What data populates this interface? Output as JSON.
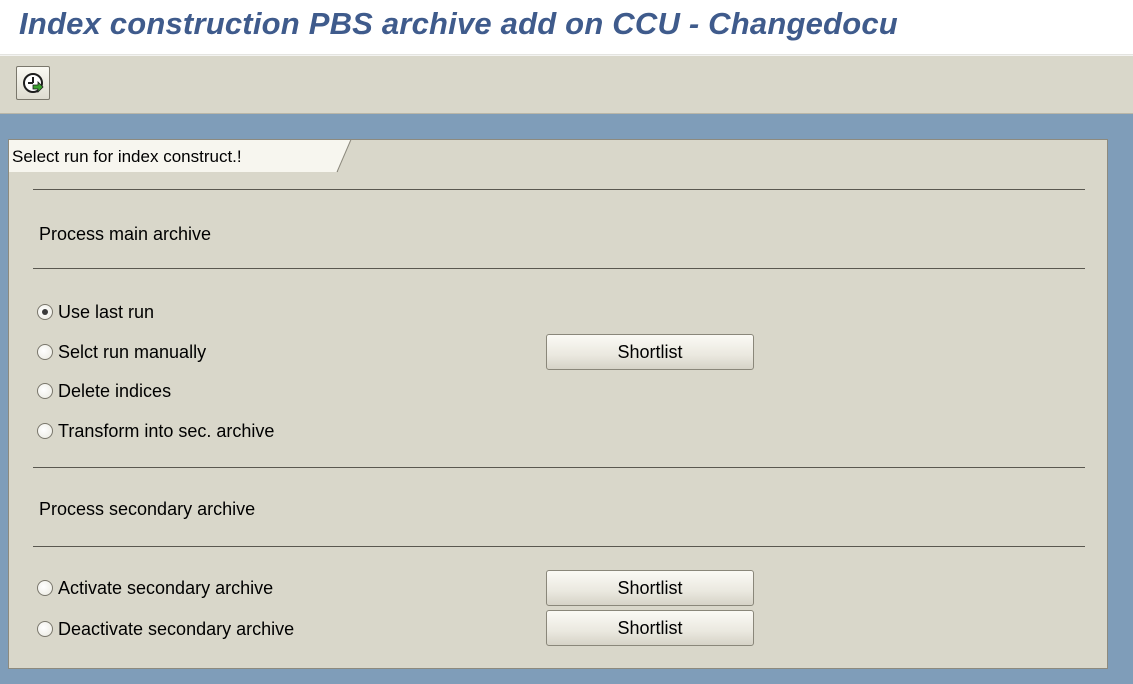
{
  "window": {
    "title": "Index construction PBS archive add on CCU - Changedocu"
  },
  "toolbar": {
    "execute_icon": "clock-execute-icon"
  },
  "tab": {
    "label": "Select run for index construct.!"
  },
  "main_archive": {
    "section_label": "Process main archive",
    "options": [
      {
        "label": "Use last run",
        "checked": true
      },
      {
        "label": "Selct run manually",
        "checked": false
      },
      {
        "label": "Delete indices",
        "checked": false
      },
      {
        "label": "Transform into sec. archive",
        "checked": false
      }
    ],
    "shortlist_label": "Shortlist"
  },
  "secondary_archive": {
    "section_label": "Process secondary archive",
    "options": [
      {
        "label": "Activate secondary archive",
        "checked": false
      },
      {
        "label": "Deactivate secondary archive",
        "checked": false
      }
    ],
    "activate_shortlist_label": "Shortlist",
    "deactivate_shortlist_label": "Shortlist"
  },
  "colors": {
    "title": "#3f5b8c",
    "toolbar_bg": "#d9d7ca",
    "workarea_bg": "#7f9db9"
  }
}
